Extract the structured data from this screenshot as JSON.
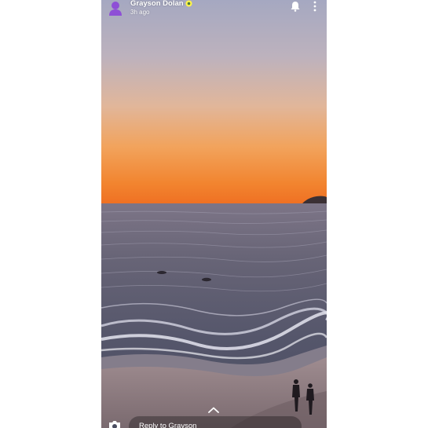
{
  "header": {
    "username": "Grayson Dolan",
    "timestamp": "3h ago",
    "avatar_icon": "bitmoji-avatar-icon",
    "badge_icon": "verified-star-icon",
    "notification_icon": "bell-icon",
    "more_icon": "more-vertical-icon"
  },
  "footer": {
    "reply_placeholder": "Reply to Grayson",
    "camera_icon": "camera-icon",
    "swipe_icon": "chevron-up-icon"
  },
  "colors": {
    "avatar": "#8e4fd6",
    "badge": "#fff54a",
    "sky_top": "#9da3bc",
    "sky_horizon": "#f2782a",
    "sea": "#5b5c72"
  }
}
